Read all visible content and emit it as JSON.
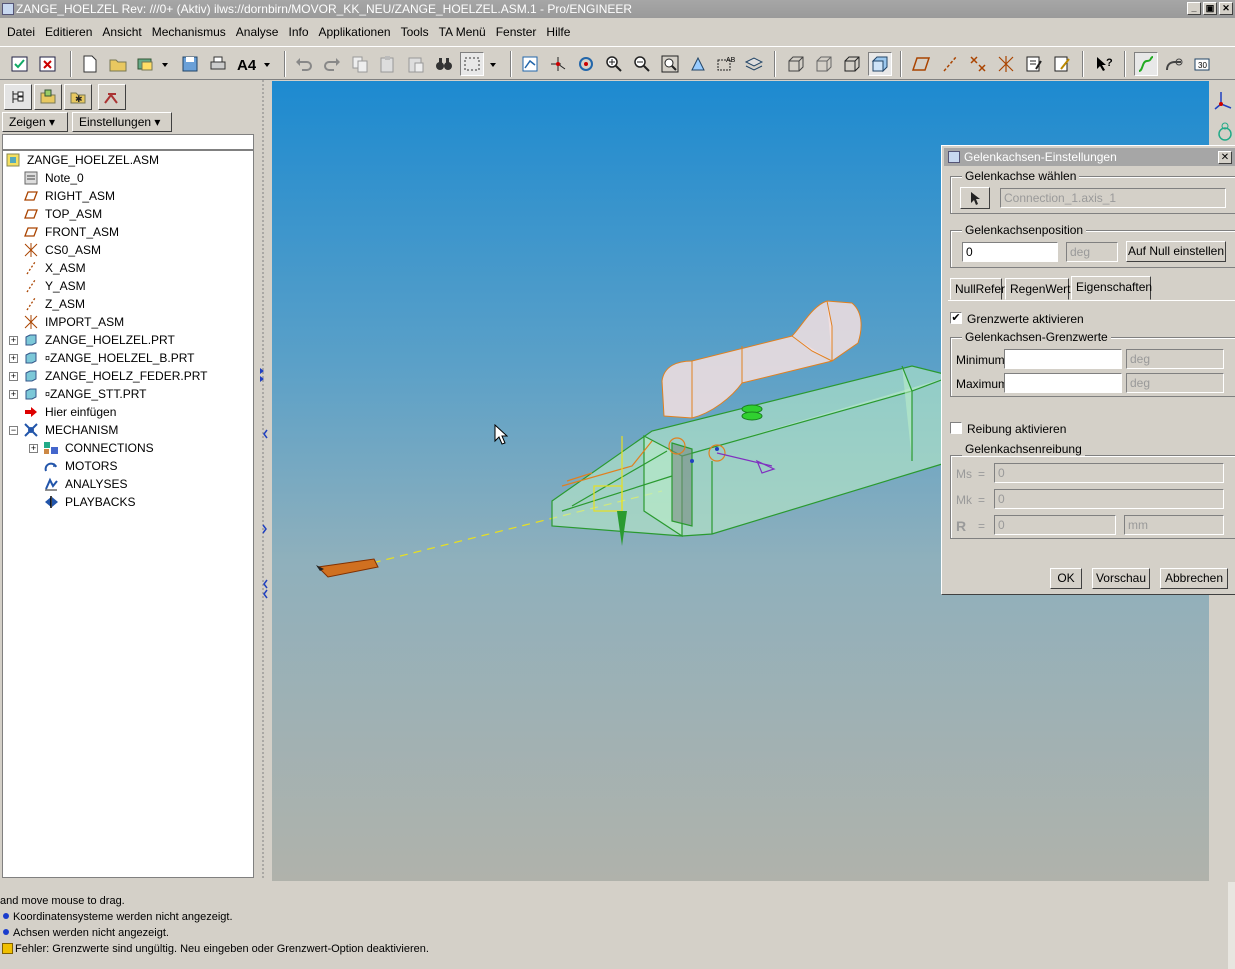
{
  "window": {
    "title": "ZANGE_HOELZEL Rev: ///0+ (Aktiv) ilws://dornbirn/MOVOR_KK_NEU/ZANGE_HOELZEL.ASM.1 - Pro/ENGINEER",
    "minimize": "_",
    "maximize": "▣",
    "close": "✕"
  },
  "menu": [
    "Datei",
    "Editieren",
    "Ansicht",
    "Mechanismus",
    "Analyse",
    "Info",
    "Applikationen",
    "Tools",
    "TA Menü",
    "Fenster",
    "Hilfe"
  ],
  "left_panel": {
    "zeigen_label": "Zeigen ▾",
    "einstellungen_label": "Einstellungen ▾",
    "tree": [
      {
        "label": "ZANGE_HOELZEL.ASM",
        "icon": "assembly-icon"
      },
      {
        "label": "Note_0",
        "icon": "note-icon"
      },
      {
        "label": "RIGHT_ASM",
        "icon": "datum-plane-icon"
      },
      {
        "label": "TOP_ASM",
        "icon": "datum-plane-icon"
      },
      {
        "label": "FRONT_ASM",
        "icon": "datum-plane-icon"
      },
      {
        "label": "CS0_ASM",
        "icon": "coordinate-system-icon"
      },
      {
        "label": "X_ASM",
        "icon": "datum-axis-icon"
      },
      {
        "label": "Y_ASM",
        "icon": "datum-axis-icon"
      },
      {
        "label": "Z_ASM",
        "icon": "datum-axis-icon"
      },
      {
        "label": "IMPORT_ASM",
        "icon": "coordinate-system-icon"
      },
      {
        "label": "ZANGE_HOELZEL.PRT",
        "icon": "part-icon"
      },
      {
        "label": "ZANGE_HOELZEL_B.PRT",
        "icon": "part-icon"
      },
      {
        "label": "ZANGE_HOELZ_FEDER.PRT",
        "icon": "part-icon"
      },
      {
        "label": "ZANGE_STT.PRT",
        "icon": "part-icon"
      },
      {
        "label": "Hier einfügen",
        "icon": "insert-arrow-icon"
      },
      {
        "label": "MECHANISM",
        "icon": "mechanism-icon"
      },
      {
        "label": "CONNECTIONS",
        "icon": "connections-icon"
      },
      {
        "label": "MOTORS",
        "icon": "motors-icon"
      },
      {
        "label": "ANALYSES",
        "icon": "analyses-icon"
      },
      {
        "label": "PLAYBACKS",
        "icon": "playbacks-icon"
      }
    ]
  },
  "dialog": {
    "title": "Gelenkachsen-Einstellungen",
    "close": "✕",
    "select_group": "Gelenkachse wählen",
    "axis_value": "Connection_1.axis_1",
    "position_group": "Gelenkachsenposition",
    "position_value": "0",
    "position_unit": "deg",
    "zero_button": "Auf Null einstellen",
    "tabs": [
      "NullRefer",
      "RegenWert",
      "Eigenschaften"
    ],
    "limits_checkbox": "Grenzwerte aktivieren",
    "limits_checked": "✔",
    "limits_group": "Gelenkachsen-Grenzwerte",
    "min_label": "Minimum",
    "min_unit": "deg",
    "max_label": "Maximum",
    "max_unit": "deg",
    "friction_checkbox": "Reibung aktivieren",
    "friction_group": "Gelenkachsenreibung",
    "mu_s_label": "Ms",
    "mu_s_value": "0",
    "mu_k_label": "Mk",
    "mu_k_value": "0",
    "r_label": "R",
    "r_value": "0",
    "r_unit": "mm",
    "equals": "=",
    "ok": "OK",
    "preview": "Vorschau",
    "cancel": "Abbrechen"
  },
  "messages": [
    "and move mouse to drag.",
    "Koordinatensysteme werden nicht angezeigt.",
    "Achsen werden nicht angezeigt.",
    "Fehler: Grenzwerte sind ungültig. Neu eingeben oder Grenzwert-Option deaktivieren."
  ],
  "colors": {
    "model_green": "#3aa040",
    "model_orange": "#e08020",
    "axis_yellow": "#e8e020"
  }
}
